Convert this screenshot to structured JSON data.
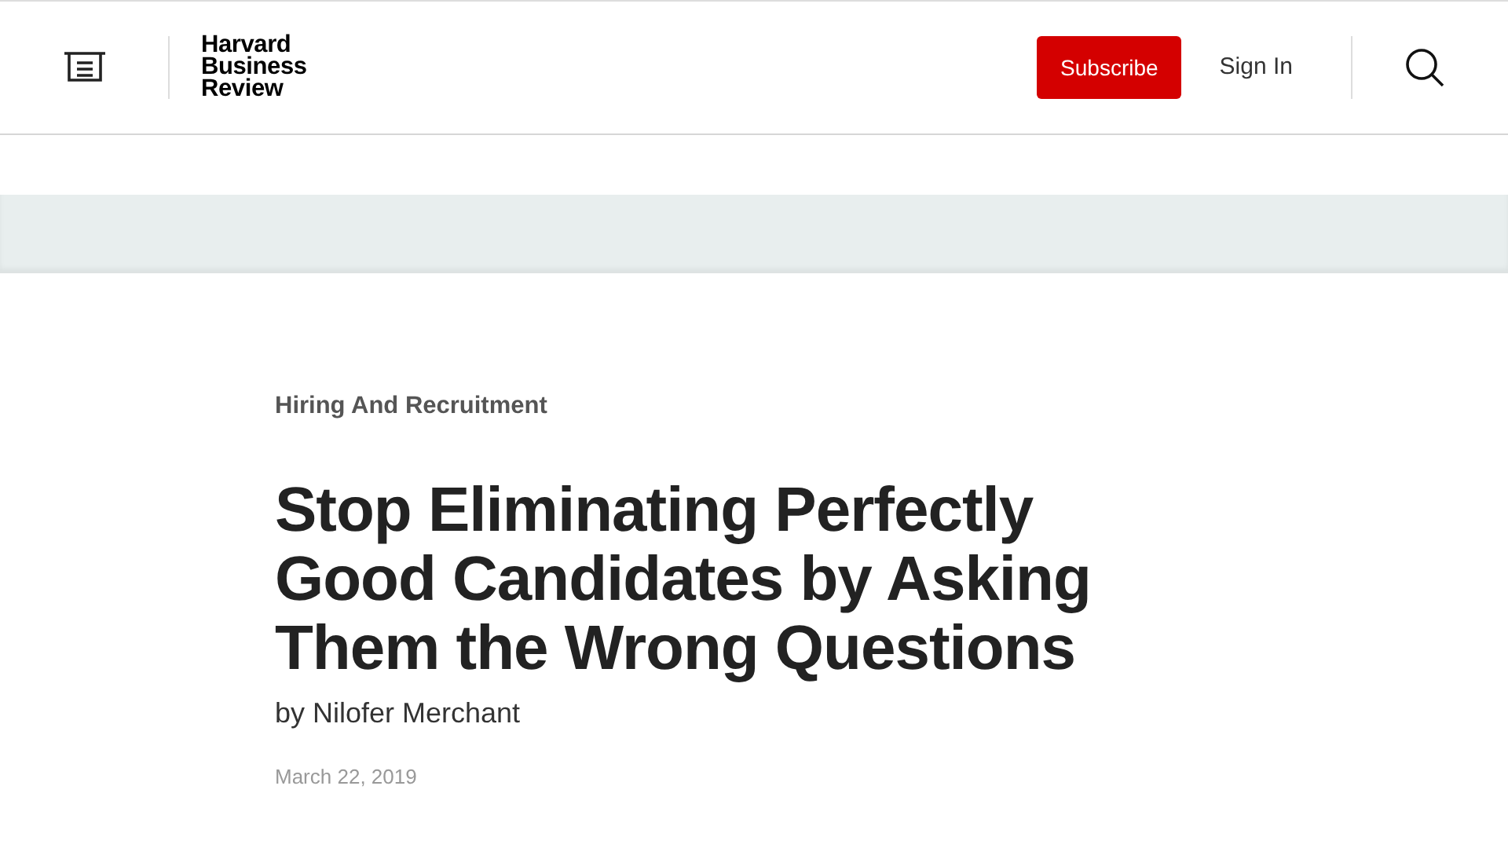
{
  "header": {
    "logo_lines": [
      "Harvard",
      "Business",
      "Review"
    ],
    "subscribe": "Subscribe",
    "sign_in": "Sign In"
  },
  "article": {
    "topic": "Hiring And Recruitment",
    "title": "Stop Eliminating Perfectly Good Candidates by Asking Them the Wrong Questions",
    "byline": "by Nilofer Merchant",
    "date": "March 22, 2019"
  }
}
